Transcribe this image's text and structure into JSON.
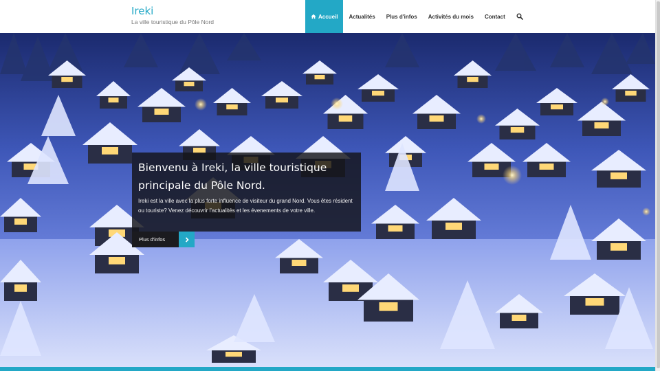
{
  "site": {
    "title": "Ireki",
    "tagline": "La ville touristique du Pôle Nord"
  },
  "nav": {
    "items": [
      {
        "label": "Accueil",
        "active": true,
        "icon": "home-icon"
      },
      {
        "label": "Actualités"
      },
      {
        "label": "Plus d'infos"
      },
      {
        "label": "Activités du mois"
      },
      {
        "label": "Contact"
      }
    ],
    "search_icon": "search-icon"
  },
  "hero": {
    "title": "Bienvenu à Ireki, la ville touristique principale du Pôle Nord.",
    "text": "Ireki est la ville avec la plus forte influence de visiteur du grand Nord. Vous êtes résident ou touriste? Venez découvrir l'actualités et les évenements de votre ville.",
    "button_label": "Plus d'infos",
    "button_icon": "chevron-right-icon"
  },
  "colors": {
    "accent": "#23a8c6",
    "caption_bg": "#141418",
    "snow": "#eef2ff",
    "night": "#1a2466"
  }
}
